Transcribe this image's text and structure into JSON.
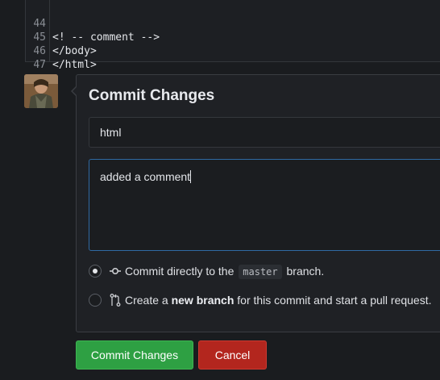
{
  "code": {
    "lines": [
      {
        "num": "44",
        "text": "<! -- comment -->"
      },
      {
        "num": "45",
        "text": "</body>"
      },
      {
        "num": "46",
        "text": "</html>"
      },
      {
        "num": "47",
        "text": ""
      }
    ]
  },
  "commit": {
    "title": "Commit Changes",
    "summary_value": "html",
    "description_value": "added a comment",
    "option_direct": {
      "prefix": "Commit directly to the",
      "branch": "master",
      "suffix": "branch.",
      "checked": true
    },
    "option_new": {
      "prefix": "Create a",
      "bold": "new branch",
      "suffix": "for this commit and start a pull request.",
      "checked": false
    },
    "commit_button": "Commit Changes",
    "cancel_button": "Cancel"
  },
  "colors": {
    "commit_button": "#2ea043",
    "cancel_button": "#b3261e",
    "focus_border": "#2f6aa3"
  },
  "icons": {
    "direct": "git-commit-icon",
    "new_branch": "git-pull-request-icon"
  }
}
